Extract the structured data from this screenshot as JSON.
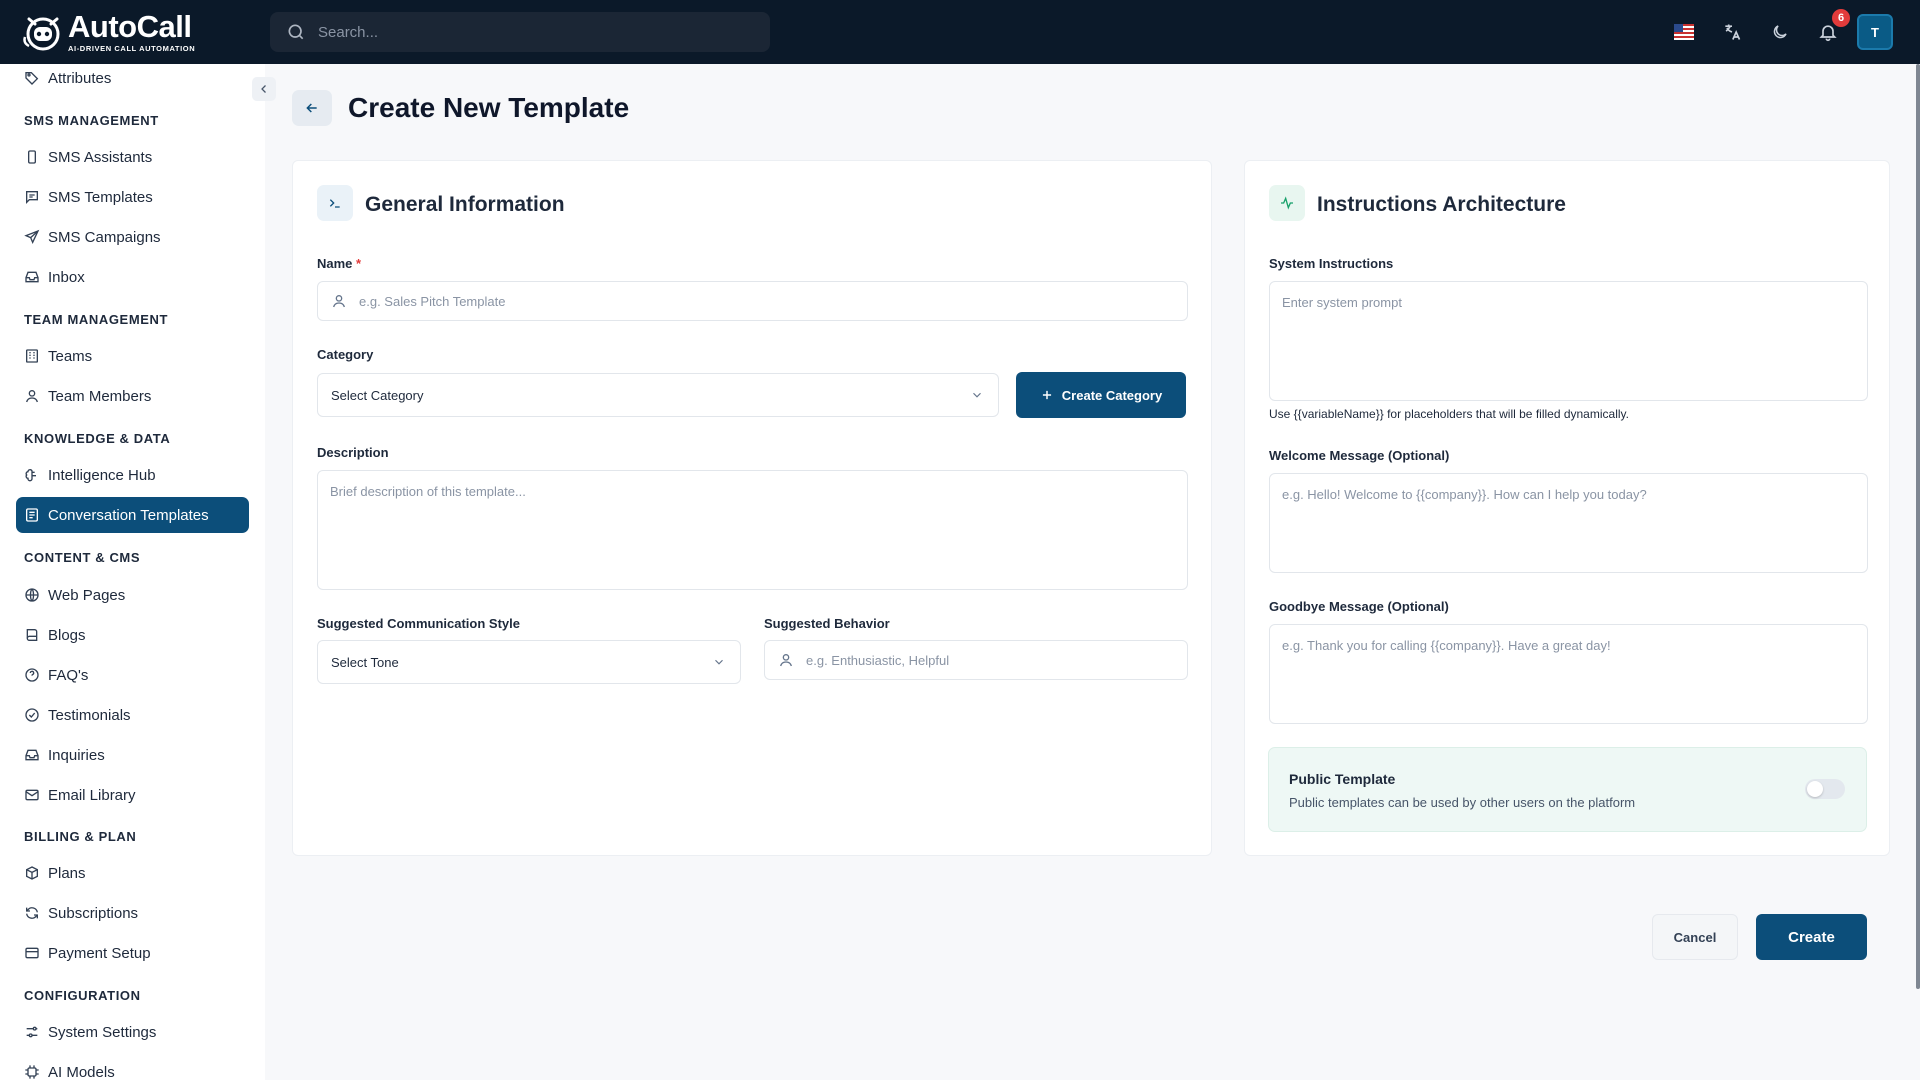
{
  "app": {
    "name": "AutoCall",
    "tagline": "AI-DRIVEN CALL AUTOMATION"
  },
  "topbar": {
    "search_placeholder": "Search...",
    "notification_count": "6",
    "user_initial": "T",
    "icons": [
      "search-icon",
      "us-flag-icon",
      "translate-icon",
      "moon-icon",
      "bell-icon"
    ]
  },
  "sidebar": {
    "items": [
      {
        "label": "Attributes",
        "icon": "tag-icon"
      },
      {
        "section": "SMS MANAGEMENT"
      },
      {
        "label": "SMS Assistants",
        "icon": "phone-icon"
      },
      {
        "label": "SMS Templates",
        "icon": "message-square-icon"
      },
      {
        "label": "SMS Campaigns",
        "icon": "send-icon"
      },
      {
        "label": "Inbox",
        "icon": "inbox-icon"
      },
      {
        "section": "TEAM MANAGEMENT"
      },
      {
        "label": "Teams",
        "icon": "building-icon"
      },
      {
        "label": "Team Members",
        "icon": "user-icon"
      },
      {
        "section": "KNOWLEDGE & DATA"
      },
      {
        "label": "Intelligence Hub",
        "icon": "brain-icon"
      },
      {
        "label": "Conversation Templates",
        "icon": "template-icon",
        "active": true
      },
      {
        "section": "CONTENT & CMS"
      },
      {
        "label": "Web Pages",
        "icon": "globe-icon"
      },
      {
        "label": "Blogs",
        "icon": "book-icon"
      },
      {
        "label": "FAQ's",
        "icon": "help-circle-icon"
      },
      {
        "label": "Testimonials",
        "icon": "check-circle-icon"
      },
      {
        "label": "Inquiries",
        "icon": "inbox-icon"
      },
      {
        "label": "Email Library",
        "icon": "mail-icon"
      },
      {
        "section": "BILLING & PLAN"
      },
      {
        "label": "Plans",
        "icon": "package-icon"
      },
      {
        "label": "Subscriptions",
        "icon": "refresh-icon"
      },
      {
        "label": "Payment Setup",
        "icon": "credit-card-icon"
      },
      {
        "section": "CONFIGURATION"
      },
      {
        "label": "System Settings",
        "icon": "sliders-icon"
      },
      {
        "label": "AI Models",
        "icon": "cpu-icon"
      }
    ]
  },
  "page": {
    "title": "Create New Template"
  },
  "general": {
    "title": "General Information",
    "name_label": "Name",
    "name_required": "*",
    "name_placeholder": "e.g. Sales Pitch Template",
    "category_label": "Category",
    "category_value": "Select Category",
    "create_category": "Create Category",
    "description_label": "Description",
    "description_placeholder": "Brief description of this template...",
    "style_label": "Suggested Communication Style",
    "style_value": "Select Tone",
    "behavior_label": "Suggested Behavior",
    "behavior_placeholder": "e.g. Enthusiastic, Helpful"
  },
  "instructions": {
    "title": "Instructions Architecture",
    "system_label": "System Instructions",
    "system_placeholder": "Enter system prompt",
    "system_hint": "Use {{variableName}} for placeholders that will be filled dynamically.",
    "welcome_label": "Welcome Message (Optional)",
    "welcome_placeholder": "e.g. Hello! Welcome to {{company}}. How can I help you today?",
    "goodbye_label": "Goodbye Message (Optional)",
    "goodbye_placeholder": "e.g. Thank you for calling {{company}}. Have a great day!",
    "public_title": "Public Template",
    "public_desc": "Public templates can be used by other users on the platform",
    "public_enabled": false
  },
  "actions": {
    "cancel": "Cancel",
    "create": "Create"
  },
  "colors": {
    "topbar": "#0b1929",
    "primary": "#0c4e7a",
    "accent_green": "#16a06a",
    "danger": "#e23b3b"
  }
}
